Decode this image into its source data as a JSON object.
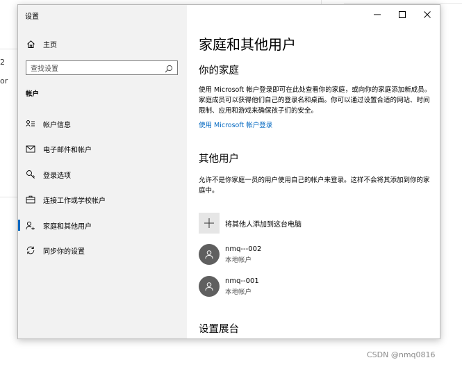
{
  "background": {
    "fragment_texts": [
      "2",
      "or"
    ],
    "watermark": "CSDN @nmq0816"
  },
  "window": {
    "title": "设置",
    "controls": {
      "minimize": "minimize-icon",
      "maximize": "maximize-icon",
      "close": "close-icon"
    }
  },
  "sidebar": {
    "home_label": "主页",
    "search_placeholder": "查找设置",
    "section_title": "帐户",
    "items": [
      {
        "label": "帐户信息",
        "icon": "account-info-icon"
      },
      {
        "label": "电子邮件和帐户",
        "icon": "mail-icon"
      },
      {
        "label": "登录选项",
        "icon": "key-icon"
      },
      {
        "label": "连接工作或学校帐户",
        "icon": "briefcase-icon"
      },
      {
        "label": "家庭和其他用户",
        "icon": "add-person-icon",
        "active": true
      },
      {
        "label": "同步你的设置",
        "icon": "sync-icon"
      }
    ]
  },
  "content": {
    "page_title": "家庭和其他用户",
    "family": {
      "heading": "你的家庭",
      "description": "使用 Microsoft 帐户登录即可在此处查看你的家庭，或向你的家庭添加新成员。家庭成员可以获得他们自己的登录名和桌面。你可以通过设置合适的网站、时间限制、应用和游戏来确保孩子们的安全。",
      "link": "使用 Microsoft 帐户登录"
    },
    "others": {
      "heading": "其他用户",
      "description": "允许不是你家庭一员的用户使用自己的帐户来登录。这样不会将其添加到你的家庭中。",
      "add_label": "将其他人添加到这台电脑",
      "users": [
        {
          "name": "nmq---002",
          "type": "本地帐户"
        },
        {
          "name": "nmq--001",
          "type": "本地帐户"
        }
      ]
    },
    "kiosk_heading": "设置展台"
  },
  "colors": {
    "accent": "#0067c0",
    "sidebar_bg": "#f2f2f2",
    "avatar_bg": "#5f5f5f"
  }
}
